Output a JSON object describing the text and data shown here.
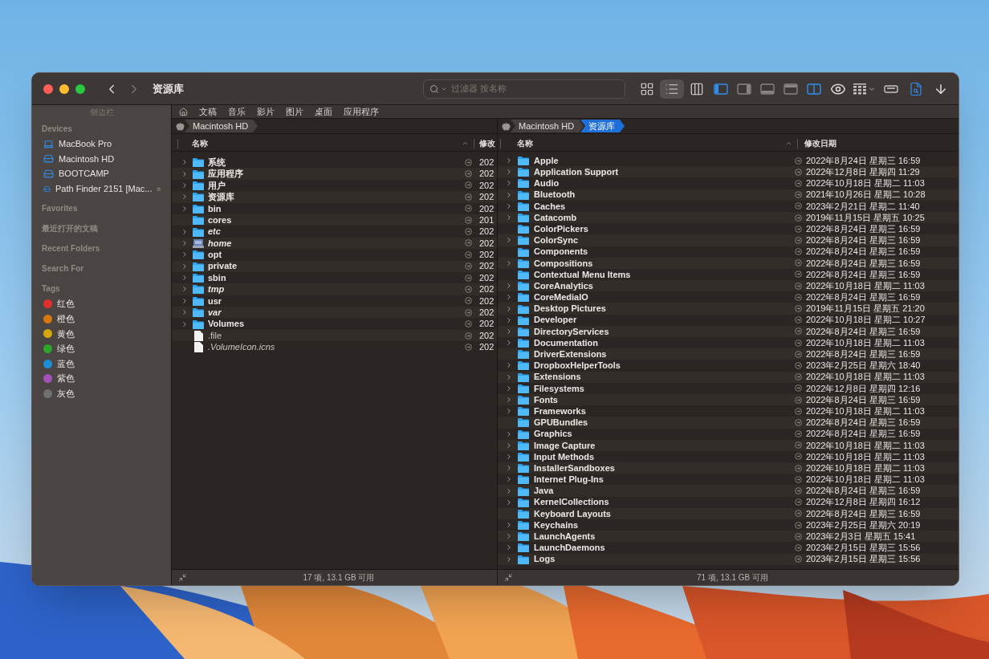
{
  "window": {
    "title": "资源库"
  },
  "search": {
    "placeholder": "过滤器 按名称"
  },
  "toolbar": [
    {
      "kind": "icons",
      "selected": false
    },
    {
      "kind": "list",
      "selected": true
    },
    {
      "kind": "columns",
      "selected": false
    },
    {
      "kind": "left-panel",
      "on": true
    },
    {
      "kind": "right-panel",
      "on": false
    },
    {
      "kind": "bottom-panel",
      "on": false
    },
    {
      "kind": "top-panel",
      "on": false
    },
    {
      "kind": "dual-pane",
      "on": true
    },
    {
      "kind": "eye"
    },
    {
      "kind": "grid-menu"
    },
    {
      "kind": "drive"
    },
    {
      "kind": "doc-search"
    },
    {
      "kind": "download"
    }
  ],
  "sidebar": {
    "title": "侧边栏",
    "sections": [
      {
        "title": "Devices",
        "items": [
          {
            "label": "MacBook Pro",
            "kind": "laptop",
            "eject": false
          },
          {
            "label": "Macintosh HD",
            "kind": "drive",
            "eject": false
          },
          {
            "label": "BOOTCAMP",
            "kind": "drive",
            "eject": false
          },
          {
            "label": "Path Finder 2151 [Mac...",
            "kind": "drive",
            "eject": true
          }
        ]
      },
      {
        "title": "Favorites"
      },
      {
        "title": "最近打开的文稿"
      },
      {
        "title": "Recent Folders"
      },
      {
        "title": "Search For"
      },
      {
        "title": "Tags",
        "items": [
          {
            "label": "红色",
            "kind": "tag",
            "color": "#e0302c"
          },
          {
            "label": "橙色",
            "kind": "tag",
            "color": "#d9770f"
          },
          {
            "label": "黄色",
            "kind": "tag",
            "color": "#d4a70b"
          },
          {
            "label": "绿色",
            "kind": "tag",
            "color": "#2ea52a"
          },
          {
            "label": "蓝色",
            "kind": "tag",
            "color": "#1a8fd6"
          },
          {
            "label": "紫色",
            "kind": "tag",
            "color": "#a450b8"
          },
          {
            "label": "灰色",
            "kind": "tag",
            "color": "#707070"
          }
        ]
      }
    ]
  },
  "shortcuts": [
    "文稿",
    "音乐",
    "影片",
    "图片",
    "桌面",
    "应用程序"
  ],
  "left_pane": {
    "path": [
      {
        "label": "Macintosh HD",
        "selected": false
      }
    ],
    "columns": [
      "名称",
      "修改"
    ],
    "rows": [
      {
        "name": "系统",
        "date": "202",
        "kind": "folder",
        "expandable": true,
        "italic": false
      },
      {
        "name": "应用程序",
        "date": "202",
        "kind": "folder",
        "expandable": true,
        "italic": false
      },
      {
        "name": "用户",
        "date": "202",
        "kind": "folder",
        "expandable": true,
        "italic": false
      },
      {
        "name": "资源库",
        "date": "202",
        "kind": "folder",
        "expandable": true,
        "italic": false
      },
      {
        "name": "bin",
        "date": "202",
        "kind": "folder",
        "expandable": true,
        "italic": false
      },
      {
        "name": "cores",
        "date": "201",
        "kind": "folder",
        "expandable": false,
        "italic": false
      },
      {
        "name": "etc",
        "date": "202",
        "kind": "folder",
        "expandable": true,
        "italic": true
      },
      {
        "name": "home",
        "date": "202",
        "kind": "server",
        "expandable": true,
        "italic": true
      },
      {
        "name": "opt",
        "date": "202",
        "kind": "folder",
        "expandable": true,
        "italic": false
      },
      {
        "name": "private",
        "date": "202",
        "kind": "folder",
        "expandable": true,
        "italic": false
      },
      {
        "name": "sbin",
        "date": "202",
        "kind": "folder",
        "expandable": true,
        "italic": false
      },
      {
        "name": "tmp",
        "date": "202",
        "kind": "folder",
        "expandable": true,
        "italic": true
      },
      {
        "name": "usr",
        "date": "202",
        "kind": "folder",
        "expandable": true,
        "italic": false
      },
      {
        "name": "var",
        "date": "202",
        "kind": "folder",
        "expandable": true,
        "italic": true
      },
      {
        "name": "Volumes",
        "date": "202",
        "kind": "folder",
        "expandable": true,
        "italic": false
      },
      {
        "name": ".file",
        "date": "202",
        "kind": "file",
        "expandable": false,
        "italic": false
      },
      {
        "name": ".VolumeIcon.icns",
        "date": "202",
        "kind": "file",
        "expandable": false,
        "italic": true
      }
    ],
    "status": "17 项, 13.1 GB 可用"
  },
  "right_pane": {
    "path": [
      {
        "label": "Macintosh HD",
        "selected": false
      },
      {
        "label": "资源库",
        "selected": true
      }
    ],
    "columns": [
      "名称",
      "修改日期"
    ],
    "rows": [
      {
        "name": "Apple",
        "date": "2022年8月24日 星期三 16:59",
        "expandable": true
      },
      {
        "name": "Application Support",
        "date": "2022年12月8日 星期四 11:29",
        "expandable": true
      },
      {
        "name": "Audio",
        "date": "2022年10月18日 星期二 11:03",
        "expandable": true
      },
      {
        "name": "Bluetooth",
        "date": "2021年10月26日 星期二 10:28",
        "expandable": true
      },
      {
        "name": "Caches",
        "date": "2023年2月21日 星期二 11:40",
        "expandable": true
      },
      {
        "name": "Catacomb",
        "date": "2019年11月15日 星期五 10:25",
        "expandable": true
      },
      {
        "name": "ColorPickers",
        "date": "2022年8月24日 星期三 16:59",
        "expandable": false
      },
      {
        "name": "ColorSync",
        "date": "2022年8月24日 星期三 16:59",
        "expandable": true
      },
      {
        "name": "Components",
        "date": "2022年8月24日 星期三 16:59",
        "expandable": false
      },
      {
        "name": "Compositions",
        "date": "2022年8月24日 星期三 16:59",
        "expandable": true
      },
      {
        "name": "Contextual Menu Items",
        "date": "2022年8月24日 星期三 16:59",
        "expandable": false
      },
      {
        "name": "CoreAnalytics",
        "date": "2022年10月18日 星期二 11:03",
        "expandable": true
      },
      {
        "name": "CoreMediaIO",
        "date": "2022年8月24日 星期三 16:59",
        "expandable": true
      },
      {
        "name": "Desktop Pictures",
        "date": "2019年11月15日 星期五 21:20",
        "expandable": true
      },
      {
        "name": "Developer",
        "date": "2022年10月18日 星期二 10:27",
        "expandable": true
      },
      {
        "name": "DirectoryServices",
        "date": "2022年8月24日 星期三 16:59",
        "expandable": true
      },
      {
        "name": "Documentation",
        "date": "2022年10月18日 星期二 11:03",
        "expandable": true
      },
      {
        "name": "DriverExtensions",
        "date": "2022年8月24日 星期三 16:59",
        "expandable": false
      },
      {
        "name": "DropboxHelperTools",
        "date": "2023年2月25日 星期六 18:40",
        "expandable": true
      },
      {
        "name": "Extensions",
        "date": "2022年10月18日 星期二 11:03",
        "expandable": true
      },
      {
        "name": "Filesystems",
        "date": "2022年12月8日 星期四 12:16",
        "expandable": true
      },
      {
        "name": "Fonts",
        "date": "2022年8月24日 星期三 16:59",
        "expandable": true
      },
      {
        "name": "Frameworks",
        "date": "2022年10月18日 星期二 11:03",
        "expandable": true
      },
      {
        "name": "GPUBundles",
        "date": "2022年8月24日 星期三 16:59",
        "expandable": false
      },
      {
        "name": "Graphics",
        "date": "2022年8月24日 星期三 16:59",
        "expandable": true
      },
      {
        "name": "Image Capture",
        "date": "2022年10月18日 星期二 11:03",
        "expandable": true
      },
      {
        "name": "Input Methods",
        "date": "2022年10月18日 星期二 11:03",
        "expandable": true
      },
      {
        "name": "InstallerSandboxes",
        "date": "2022年10月18日 星期二 11:03",
        "expandable": true
      },
      {
        "name": "Internet Plug-Ins",
        "date": "2022年10月18日 星期二 11:03",
        "expandable": true
      },
      {
        "name": "Java",
        "date": "2022年8月24日 星期三 16:59",
        "expandable": true
      },
      {
        "name": "KernelCollections",
        "date": "2022年12月8日 星期四 16:12",
        "expandable": true
      },
      {
        "name": "Keyboard Layouts",
        "date": "2022年8月24日 星期三 16:59",
        "expandable": false
      },
      {
        "name": "Keychains",
        "date": "2023年2月25日 星期六 20:19",
        "expandable": true
      },
      {
        "name": "LaunchAgents",
        "date": "2023年2月3日 星期五 15:41",
        "expandable": true
      },
      {
        "name": "LaunchDaemons",
        "date": "2023年2月15日 星期三 15:56",
        "expandable": true
      },
      {
        "name": "Logs",
        "date": "2023年2月15日 星期三 15:56",
        "expandable": true
      }
    ],
    "status": "71 项, 13.1 GB 可用"
  }
}
